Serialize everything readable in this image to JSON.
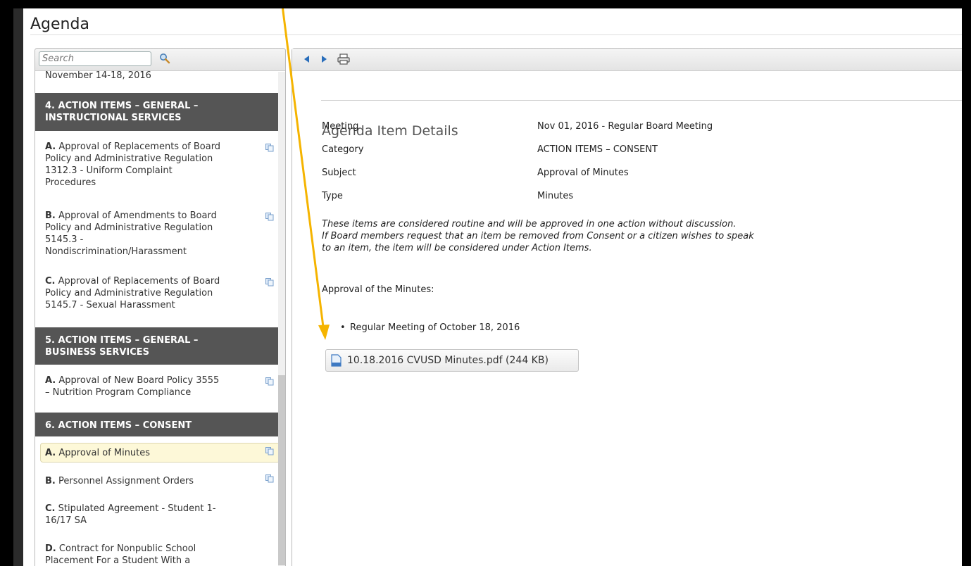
{
  "page": {
    "title": "Agenda"
  },
  "search": {
    "placeholder": "Search"
  },
  "sidebar": {
    "cut_heading": "November 14-18, 2016",
    "sections": [
      {
        "header_line1": "4. ACTION ITEMS – GENERAL –",
        "header_line2": "INSTRUCTIONAL SERVICES",
        "items": [
          {
            "letter": "A.",
            "text_lines": [
              "Approval of Replacements of Board",
              "Policy and Administrative Regulation",
              "1312.3 - Uniform Complaint",
              "Procedures"
            ]
          },
          {
            "letter": "B.",
            "text_lines": [
              "Approval of Amendments to Board",
              "Policy and Administrative Regulation",
              "5145.3 -",
              "Nondiscrimination/Harassment"
            ]
          },
          {
            "letter": "C.",
            "text_lines": [
              "Approval of Replacements of Board",
              "Policy and Administrative Regulation",
              "5145.7 - Sexual Harassment"
            ]
          }
        ]
      },
      {
        "header_line1": "5. ACTION ITEMS – GENERAL –",
        "header_line2": "BUSINESS SERVICES",
        "items": [
          {
            "letter": "A.",
            "text_lines": [
              "Approval of New Board Policy 3555",
              "– Nutrition Program Compliance"
            ]
          }
        ]
      },
      {
        "header_line1": "6. ACTION ITEMS – CONSENT",
        "items": [
          {
            "letter": "A.",
            "text_lines": [
              "Approval of Minutes"
            ],
            "selected": true
          },
          {
            "letter": "B.",
            "text_lines": [
              "Personnel Assignment Orders"
            ]
          },
          {
            "letter": "C.",
            "text_lines": [
              "Stipulated Agreement - Student 1-",
              "16/17 SA"
            ]
          },
          {
            "letter": "D.",
            "text_lines": [
              "Contract for Nonpublic School",
              "Placement For a Student With a"
            ]
          }
        ]
      }
    ]
  },
  "details": {
    "title": "Agenda Item Details",
    "rows": [
      {
        "label": "Meeting",
        "value": "Nov 01, 2016 - Regular Board Meeting"
      },
      {
        "label": "Category",
        "value": "ACTION ITEMS – CONSENT"
      },
      {
        "label": "Subject",
        "value": "Approval of Minutes"
      },
      {
        "label": "Type",
        "value": "Minutes"
      }
    ],
    "note_lines": [
      "These items are considered routine and will be approved in one action without discussion.",
      "If Board members request that an item be removed from Consent or a citizen wishes to speak",
      "to an item, the item will be considered under Action Items."
    ],
    "minutes_label": "Approval of the Minutes:",
    "bullet": "Regular Meeting of October 18, 2016",
    "attachment": "10.18.2016 CVUSD Minutes.pdf (244 KB)"
  },
  "icons": {
    "back": "back-arrow-icon",
    "forward": "forward-arrow-icon",
    "print": "print-icon",
    "search": "search-icon",
    "copy": "copy-icon",
    "pdf": "pdf-file-icon"
  },
  "colors": {
    "section_header_bg": "#555555",
    "selected_bg": "#fdf8d8",
    "annotation_arrow": "#f5b400",
    "nav_arrow": "#2a6ebb"
  }
}
